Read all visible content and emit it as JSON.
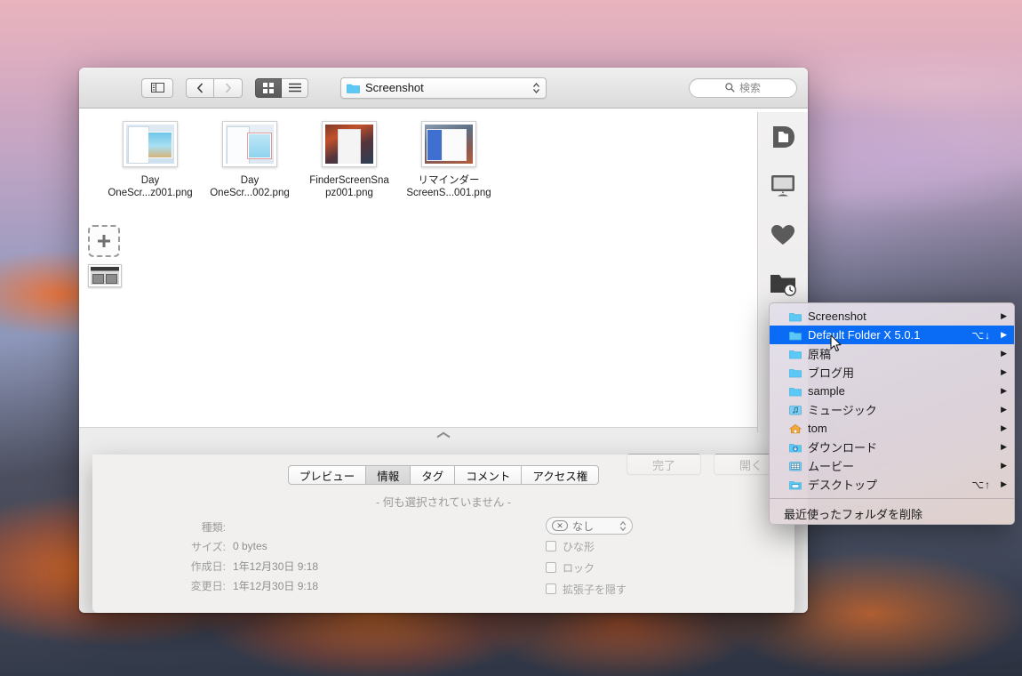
{
  "window": {
    "toolbar": {
      "sidebar_toggle_icon": "sidebar-toggle-icon",
      "back_icon": "chevron-left-icon",
      "forward_icon": "chevron-right-icon",
      "icon_view_icon": "grid-view-icon",
      "list_view_icon": "list-view-icon",
      "path_label": "Screenshot",
      "path_folder_icon": "folder-icon",
      "path_stepper_icon": "updown-chevron-icon",
      "search_icon": "search-icon",
      "search_placeholder": "検索"
    },
    "files": [
      {
        "name_line1": "Day",
        "name_line2": "OneScr...z001.png",
        "thumb": "t1"
      },
      {
        "name_line1": "Day",
        "name_line2": "OneScr...002.png",
        "thumb": "t2"
      },
      {
        "name_line1": "FinderScreenSna",
        "name_line2": "pz001.png",
        "thumb": "t3"
      },
      {
        "name_line1": "リマインダー",
        "name_line2": "ScreenS...001.png",
        "thumb": "t4"
      }
    ],
    "collapse_icon": "chevron-up-icon",
    "actions": {
      "done_label": "完了",
      "open_label": "開く"
    }
  },
  "info_panel": {
    "tabs": [
      {
        "label": "プレビュー",
        "active": false
      },
      {
        "label": "情報",
        "active": true
      },
      {
        "label": "タグ",
        "active": false
      },
      {
        "label": "コメント",
        "active": false
      },
      {
        "label": "アクセス権",
        "active": false
      }
    ],
    "empty_message": "- 何も選択されていません -",
    "meta": [
      {
        "key": "種類:",
        "value": ""
      },
      {
        "key": "サイズ:",
        "value": "0 bytes"
      },
      {
        "key": "作成日:",
        "value": "1年12月30日 9:18"
      },
      {
        "key": "変更日:",
        "value": "1年12月30日 9:18"
      }
    ],
    "tag_select": {
      "clear_icon": "clear-tag-icon",
      "value": "なし",
      "stepper_icon": "updown-chevron-icon"
    },
    "checkboxes": [
      {
        "label": "ひな形",
        "checked": false
      },
      {
        "label": "ロック",
        "checked": false
      },
      {
        "label": "拡張子を隠す",
        "checked": false
      }
    ]
  },
  "dfx_sidebar": {
    "items": [
      {
        "icon": "default-folder-x-logo-icon"
      },
      {
        "icon": "display-monitor-icon"
      },
      {
        "icon": "heart-favorites-icon"
      },
      {
        "icon": "recent-folders-clock-icon"
      }
    ]
  },
  "left_palette": {
    "add_icon": "add-plus-icon",
    "preview_thumb_icon": "window-preview-icon"
  },
  "recent_menu": {
    "items": [
      {
        "label": "Screenshot",
        "icon": "folder-icon",
        "shortcut": "",
        "arrow": "▶",
        "selected": false
      },
      {
        "label": "Default Folder X 5.0.1",
        "icon": "folder-icon",
        "shortcut": "⌥↓",
        "arrow": "▶",
        "selected": true
      },
      {
        "label": "原稿",
        "icon": "folder-icon",
        "shortcut": "",
        "arrow": "▶",
        "selected": false
      },
      {
        "label": "ブログ用",
        "icon": "folder-icon",
        "shortcut": "",
        "arrow": "▶",
        "selected": false
      },
      {
        "label": "sample",
        "icon": "folder-icon",
        "shortcut": "",
        "arrow": "▶",
        "selected": false
      },
      {
        "label": "ミュージック",
        "icon": "music-folder-icon",
        "shortcut": "",
        "arrow": "▶",
        "selected": false
      },
      {
        "label": "tom",
        "icon": "home-folder-icon",
        "shortcut": "",
        "arrow": "▶",
        "selected": false
      },
      {
        "label": "ダウンロード",
        "icon": "downloads-folder-icon",
        "shortcut": "",
        "arrow": "▶",
        "selected": false
      },
      {
        "label": "ムービー",
        "icon": "movies-folder-icon",
        "shortcut": "",
        "arrow": "▶",
        "selected": false
      },
      {
        "label": "デスクトップ",
        "icon": "desktop-folder-icon",
        "shortcut": "⌥↑",
        "arrow": "▶",
        "selected": false
      }
    ],
    "footer_label": "最近使ったフォルダを削除"
  },
  "colors": {
    "selection_blue": "#0a6cf5",
    "folder_blue": "#5bc8f5",
    "window_chrome": "#ececec"
  }
}
